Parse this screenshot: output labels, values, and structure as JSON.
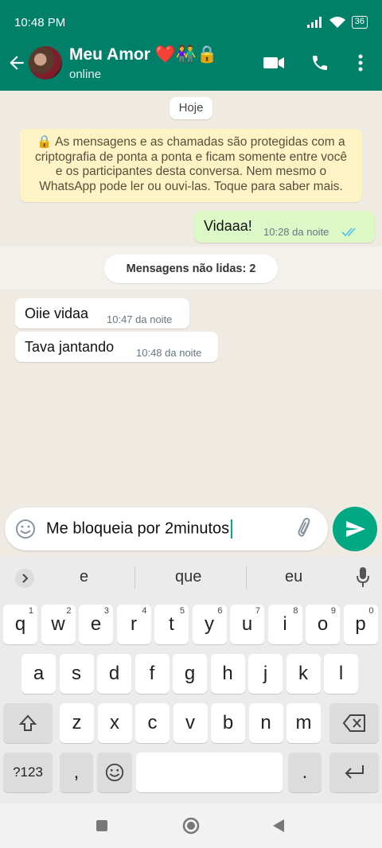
{
  "status_bar": {
    "time": "10:48 PM",
    "battery": "36"
  },
  "header": {
    "contact_name": "Meu Amor ❤️👫🔒",
    "contact_status": "online"
  },
  "chat": {
    "date_chip": "Hoje",
    "encryption_notice": "🔒 As mensagens e as chamadas são protegidas com a criptografia de ponta a ponta e ficam somente entre você e os participantes desta conversa. Nem mesmo o WhatsApp pode ler ou ouvi-las. Toque para saber mais.",
    "unread_label": "Mensagens não lidas: 2",
    "messages": [
      {
        "direction": "out",
        "text": "Vidaaa!",
        "time": "10:28 da noite",
        "status": "read"
      },
      {
        "direction": "in",
        "text": "Oiie vidaa",
        "time": "10:47 da noite"
      },
      {
        "direction": "in",
        "text": "Tava jantando",
        "time": "10:48 da noite"
      }
    ]
  },
  "composer": {
    "value": "Me bloqueia por 2minutos"
  },
  "keyboard": {
    "suggestions": [
      "e",
      "que",
      "eu"
    ],
    "row1": [
      {
        "k": "q",
        "n": "1"
      },
      {
        "k": "w",
        "n": "2"
      },
      {
        "k": "e",
        "n": "3"
      },
      {
        "k": "r",
        "n": "4"
      },
      {
        "k": "t",
        "n": "5"
      },
      {
        "k": "y",
        "n": "6"
      },
      {
        "k": "u",
        "n": "7"
      },
      {
        "k": "i",
        "n": "8"
      },
      {
        "k": "o",
        "n": "9"
      },
      {
        "k": "p",
        "n": "0"
      }
    ],
    "row2": [
      "a",
      "s",
      "d",
      "f",
      "g",
      "h",
      "j",
      "k",
      "l"
    ],
    "row3": [
      "z",
      "x",
      "c",
      "v",
      "b",
      "n",
      "m"
    ],
    "symbols_label": "?123",
    "comma": ",",
    "period": "."
  },
  "colors": {
    "header": "#008069",
    "accent": "#00a884",
    "outgoing_bubble": "#dcf8c6",
    "chat_bg": "#efeae2"
  }
}
